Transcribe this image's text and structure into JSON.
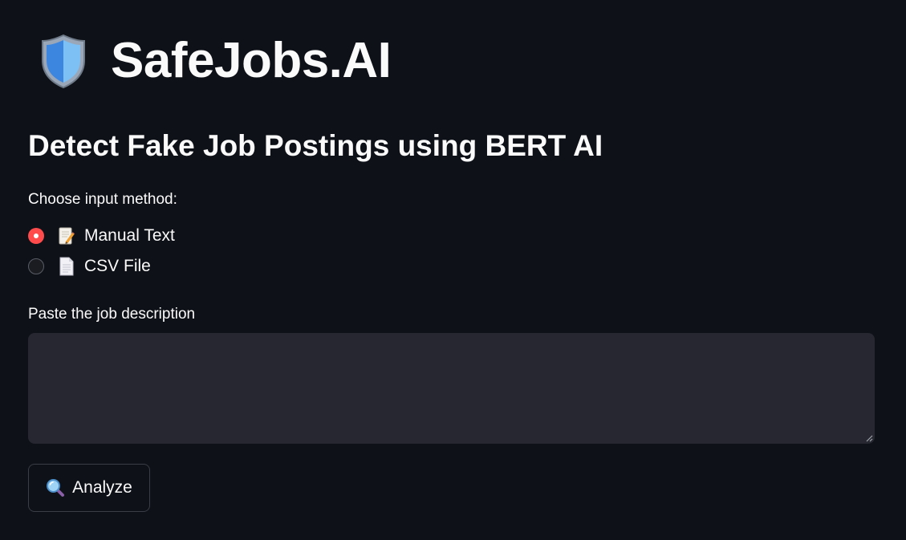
{
  "header": {
    "app_title": "SafeJobs.AI",
    "logo_icon": "shield-icon",
    "subtitle": "Detect Fake Job Postings using BERT AI"
  },
  "input_method": {
    "label": "Choose input method:",
    "options": [
      {
        "icon": "memo-icon",
        "label": "Manual Text",
        "selected": true
      },
      {
        "icon": "page-icon",
        "label": "CSV File",
        "selected": false
      }
    ]
  },
  "job_description": {
    "label": "Paste the job description",
    "value": "",
    "placeholder": ""
  },
  "analyze_button": {
    "icon": "magnifier-icon",
    "label": "Analyze"
  },
  "colors": {
    "background": "#0e1117",
    "input_background": "#262730",
    "accent": "#ff4b4b",
    "text": "#fafafa"
  }
}
